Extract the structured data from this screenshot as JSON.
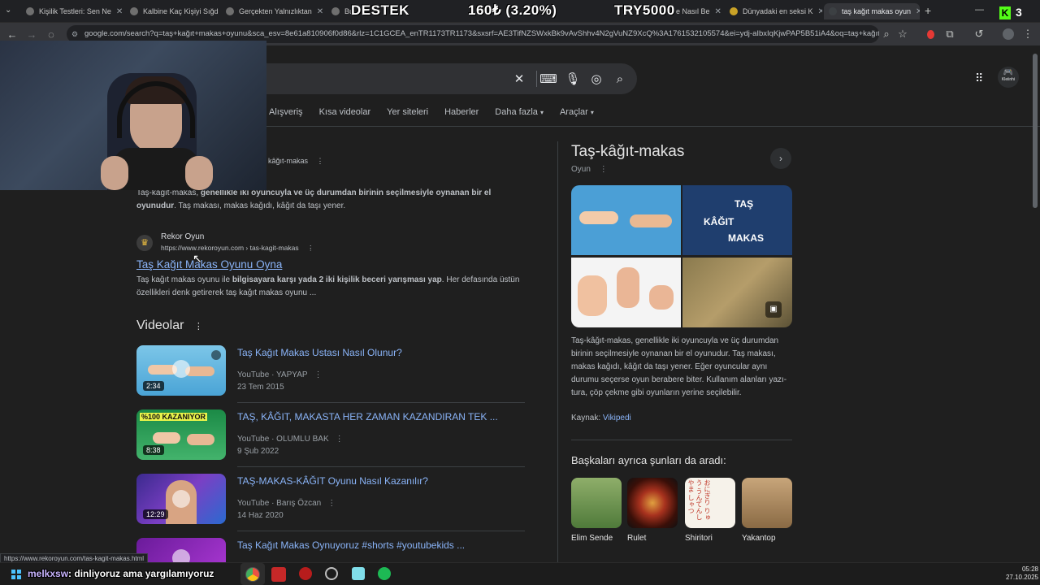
{
  "tabs": [
    {
      "label": "Kişilik Testleri: Sen Ne"
    },
    {
      "label": "Kalbine Kaç Kişiyi Sığd"
    },
    {
      "label": "Gerçekten Yalnızlıktan"
    },
    {
      "label": "Bu"
    },
    {
      "label": "e Nasıl Be"
    },
    {
      "label": "Dünyadaki en seksi K"
    },
    {
      "label": "taş kağıt makas oyun"
    }
  ],
  "stream_overlay": {
    "destek": "DESTEK",
    "amount": "160₺ (3.20%)",
    "code": "TRY5000",
    "kick_count": "3"
  },
  "address_bar": {
    "url": "google.com/search?q=taş+kağıt+makas+oyunu&sca_esv=8e61a810906f0d86&rlz=1C1GCEA_enTR1173TR1173&sxsrf=AE3TifNZSWxkBk9vAvShhv4N2gVuNZ9XcQ%3A1761532105574&ei=ydj-aIbxIqKjwPAP5B51iA4&oq=taş+kağıt+m..."
  },
  "search_nav": {
    "items": [
      "Alışveriş",
      "Kısa videolar",
      "Yer siteleri",
      "Haberler",
      "Daha fazla",
      "Araçlar"
    ]
  },
  "profile_label": "Kleiinhi",
  "result1": {
    "crumb": "kâğıt-makas",
    "snippet_plain1": "Taş-kâğıt-makas, ",
    "snippet_bold": "genellikle iki oyuncuyla ve üç durumdan birinin seçilmesiyle oynanan bir el oyunudur",
    "snippet_plain2": ". Taş makası, makas kağıdı, kâğıt da taşı yener."
  },
  "result2": {
    "site": "Rekor Oyun",
    "url": "https://www.rekoroyun.com › tas-kagit-makas",
    "title": "Taş Kağıt Makas Oyunu Oyna",
    "snippet_plain1": "Taş kağıt makas oyunu ile ",
    "snippet_bold": "bilgisayara karşı yada 2 iki kişilik beceri yarışması yap",
    "snippet_plain2": ". Her defasında üstün özellikleri denk getirerek taş kağıt makas oyunu ..."
  },
  "videos": {
    "heading": "Videolar",
    "items": [
      {
        "title": "Taş Kağıt Makas Ustası Nasıl Olunur?",
        "source": "YouTube · YAPYAP",
        "date": "23 Tem 2015",
        "duration": "2:34"
      },
      {
        "title": "TAŞ, KÂĞIT, MAKASTA HER ZAMAN KAZANDIRAN TEK ...",
        "source": "YouTube · OLUMLU BAK",
        "date": "9 Şub 2022",
        "duration": "8:38",
        "thumb_text": "%100 KAZANIYOR"
      },
      {
        "title": "TAŞ-MAKAS-KÂĞIT Oyunu Nasıl Kazanılır?",
        "source": "YouTube · Barış Özcan",
        "date": "14 Haz 2020",
        "duration": "12:29"
      },
      {
        "title": "Taş Kağıt Makas Oynuyoruz #shorts #youtubekids ...",
        "source": "",
        "date": "",
        "duration": ""
      }
    ]
  },
  "knowledge_panel": {
    "title": "Taş-kâğıt-makas",
    "subtitle": "Oyun",
    "image_text": [
      "TAŞ",
      "KÂĞIT",
      "MAKAS"
    ],
    "description": "Taş-kâğıt-makas, genellikle iki oyuncuyla ve üç durumdan birinin seçilmesiyle oynanan bir el oyunudur. Taş makası, makas kağıdı, kâğıt da taşı yener. Eğer oyuncular aynı durumu seçerse oyun berabere biter. Kullanım alanları yazı-tura, çöp çekme gibi oyunların yerine seçilebilir.",
    "source_label": "Kaynak:",
    "source_link": "Vikipedi",
    "also_heading": "Başkaları ayrıca şunları da aradı:",
    "also": [
      {
        "label": "Elim Sende"
      },
      {
        "label": "Rulet"
      },
      {
        "label": "Shiritori",
        "image_text": "おにぎり りゅう うんてんし やま しゃつ"
      },
      {
        "label": "Yakantop"
      }
    ]
  },
  "status_url": "https://www.rekoroyun.com/tas-kagit-makas.html",
  "chat": {
    "user": "melkxsw",
    "message": ": dinliyoruz ama yargılamıyoruz"
  },
  "clock": {
    "time": "05:28",
    "date": "27.10.2025"
  },
  "colors": {
    "link": "#8ab4f8",
    "background": "#1f1f1f",
    "kick_green": "#53fc18"
  }
}
